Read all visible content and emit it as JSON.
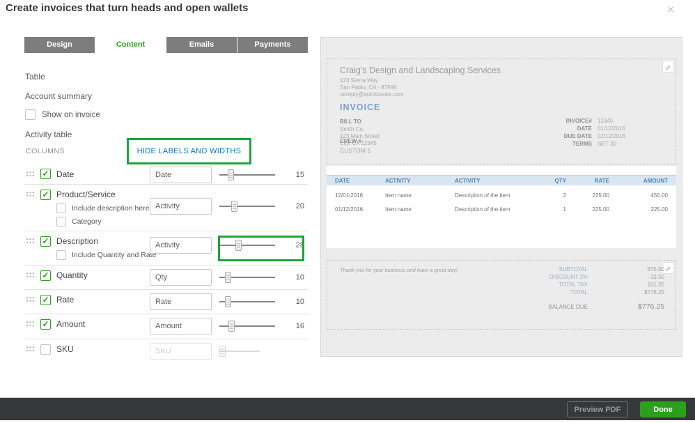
{
  "dialog": {
    "title": "Create invoices that turn heads and open wallets"
  },
  "tabs": [
    {
      "label": "Design",
      "active": false
    },
    {
      "label": "Content",
      "active": true
    },
    {
      "label": "Emails",
      "active": false
    },
    {
      "label": "Payments",
      "active": false
    }
  ],
  "left_panel": {
    "table_label": "Table",
    "account_summary_label": "Account summary",
    "show_on_invoice_label": "Show on invoice",
    "show_on_invoice_checked": false,
    "activity_table_label": "Activity table",
    "columns_label": "COLUMNS",
    "hide_link_label": "HIDE LABELS AND WIDTHS",
    "columns": [
      {
        "label": "Date",
        "checked": true,
        "input_value": "Date",
        "width": "15",
        "sub_options": []
      },
      {
        "label": "Product/Service",
        "checked": true,
        "input_value": "Activity",
        "width": "20",
        "sub_options": [
          {
            "label": "Include description here",
            "checked": false
          },
          {
            "label": "Category",
            "checked": false
          }
        ]
      },
      {
        "label": "Description",
        "checked": true,
        "input_value": "Activity",
        "width": "28",
        "highlighted": true,
        "sub_options": [
          {
            "label": "Include Quantity and Rate",
            "checked": false
          }
        ]
      },
      {
        "label": "Quantity",
        "checked": true,
        "input_value": "Qty",
        "width": "10",
        "sub_options": []
      },
      {
        "label": "Rate",
        "checked": true,
        "input_value": "Rate",
        "width": "10",
        "sub_options": []
      },
      {
        "label": "Amount",
        "checked": true,
        "input_value": "Amount",
        "width": "16",
        "sub_options": []
      },
      {
        "label": "SKU",
        "checked": false,
        "input_placeholder": "SKU",
        "width": "",
        "disabled": true,
        "sub_options": []
      }
    ]
  },
  "preview": {
    "company": {
      "name": "Craig's Design and Landscaping Services",
      "address1": "123 Sierra Way",
      "address2": "San Pablo, CA - 87999",
      "email": "noreply@quickbooks.com"
    },
    "invoice_title": "INVOICE",
    "bill_to": {
      "label": "BILL TO",
      "line1": "Smith Co.",
      "line2": "123 Main Street",
      "line3": "City, CA 12345"
    },
    "meta": [
      {
        "label": "INVOICE#",
        "value": "12345"
      },
      {
        "label": "DATE",
        "value": "01/12/2016"
      },
      {
        "label": "DUE DATE",
        "value": "02/12/2016"
      },
      {
        "label": "TERMS",
        "value": "NET 30"
      }
    ],
    "custom_field": {
      "label": "CREW #",
      "value": "CUSTOM-1"
    },
    "table": {
      "headers": [
        "DATE",
        "ACTIVITY",
        "ACTIVITY",
        "QTY",
        "RATE",
        "AMOUNT"
      ],
      "rows": [
        [
          "12/01/2016",
          "Item name",
          "Description of the item",
          "2",
          "225.00",
          "450.00"
        ],
        [
          "01/12/2016",
          "Item name",
          "Description of the item",
          "1",
          "225.00",
          "225.00"
        ]
      ]
    },
    "footer_message": "Thank you for your business and have a great day!",
    "totals": [
      {
        "label": "SUBTOTAL",
        "value": "675.00"
      },
      {
        "label": "DISCOUNT 2%",
        "value": "-13.50"
      },
      {
        "label": "TOTAL TAX",
        "value": "101.25"
      },
      {
        "label": "TOTAL",
        "value": "$776.25"
      }
    ],
    "balance_due": {
      "label": "BALANCE DUE",
      "value": "$776.25"
    }
  },
  "footer": {
    "preview_pdf_label": "Preview PDF",
    "done_label": "Done"
  },
  "colors": {
    "accent_green": "#2ca01c",
    "annotation_green": "#1fa43c",
    "link_blue": "#0077c5",
    "invoice_blue": "#7ba1c7",
    "footer_bar": "#37383c",
    "preview_bg": "#ececec"
  }
}
